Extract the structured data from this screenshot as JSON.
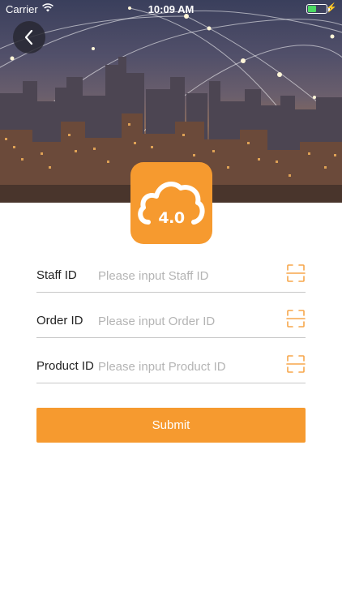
{
  "status_bar": {
    "carrier": "Carrier",
    "time": "10:09 AM"
  },
  "header": {
    "back_icon": "chevron-left-icon",
    "logo_text": "4.0",
    "logo_icon": "cloud-icon"
  },
  "form": {
    "fields": [
      {
        "label": "Staff ID",
        "placeholder": "Please input Staff ID",
        "value": "",
        "icon": "scan-icon"
      },
      {
        "label": "Order ID",
        "placeholder": "Please input Order ID",
        "value": "",
        "icon": "scan-icon"
      },
      {
        "label": "Product ID",
        "placeholder": "Please input Product ID",
        "value": "",
        "icon": "scan-icon"
      }
    ],
    "submit_label": "Submit"
  },
  "colors": {
    "accent": "#f69a2f",
    "scan_icon": "#f7a64a",
    "battery": "#4cd964"
  }
}
